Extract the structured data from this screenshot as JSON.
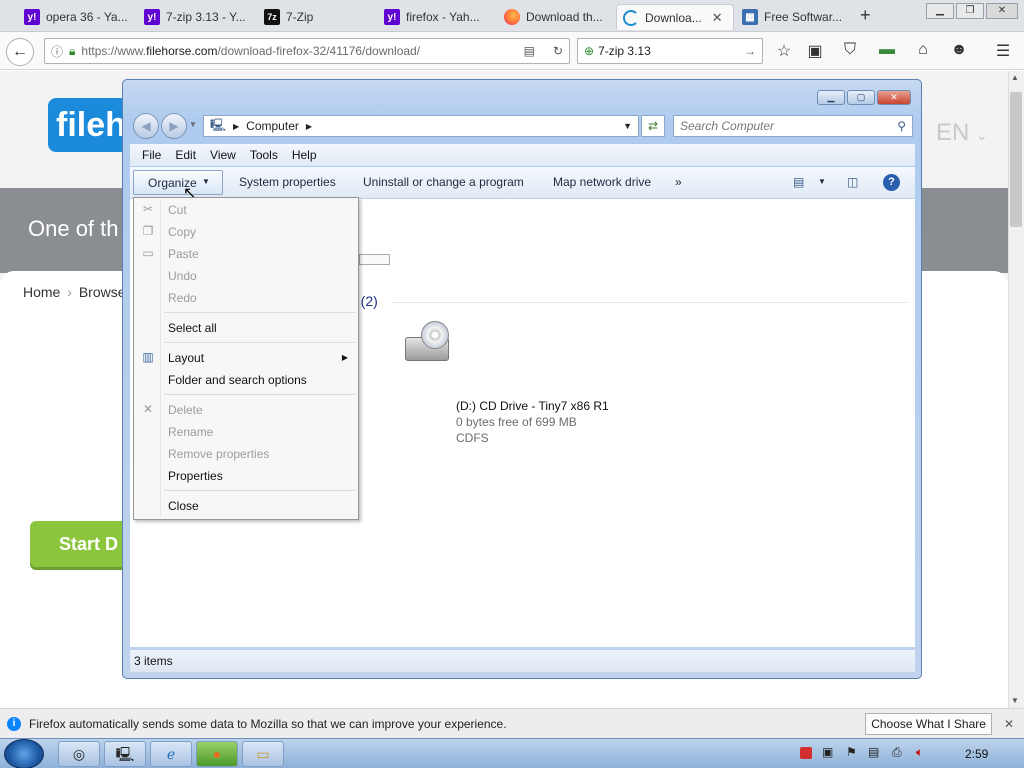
{
  "browser": {
    "tabs": [
      {
        "label": "opera 36 - Ya...",
        "icon": "yahoo-icon"
      },
      {
        "label": "7-zip 3.13 - Y...",
        "icon": "yahoo-icon"
      },
      {
        "label": "7-Zip",
        "icon": "7zip-icon"
      },
      {
        "label": "firefox - Yah...",
        "icon": "yahoo-icon"
      },
      {
        "label": "Download th...",
        "icon": "firefox-icon"
      },
      {
        "label": "Downloa...",
        "icon": "loading-icon",
        "active": true
      },
      {
        "label": "Free Softwar...",
        "icon": "filehorse-icon"
      }
    ],
    "new_tab": "+",
    "url_prefix": "https://www.",
    "url_domain": "filehorse.com",
    "url_path": "/download-firefox-32/41176/download/",
    "search_value": "7-zip 3.13"
  },
  "page": {
    "logo_text": "fileh",
    "lang": "EN",
    "banner_text": "One of th",
    "breadcrumb_home": "Home",
    "breadcrumb_browse": "Browse",
    "start_button": "Start D"
  },
  "explorer": {
    "address_root": "Computer",
    "search_placeholder": "Search Computer",
    "menu": [
      "File",
      "Edit",
      "View",
      "Tools",
      "Help"
    ],
    "commands": {
      "organize": "Organize",
      "system_properties": "System properties",
      "uninstall": "Uninstall or change a program",
      "map_drive": "Map network drive",
      "more": "»"
    },
    "group_header": "e (2)",
    "drive": {
      "name": "(D:) CD Drive - Tiny7 x86 R1",
      "free": "0 bytes free of 699 MB",
      "fs": "CDFS"
    },
    "status": "3 items"
  },
  "organize_menu": [
    {
      "label": "Cut",
      "disabled": true
    },
    {
      "label": "Copy",
      "disabled": true
    },
    {
      "label": "Paste",
      "disabled": true
    },
    {
      "label": "Undo",
      "disabled": true
    },
    {
      "label": "Redo",
      "disabled": true
    },
    {
      "label": "Select all",
      "disabled": false
    },
    {
      "label": "Layout",
      "disabled": false
    },
    {
      "label": "Folder and search options",
      "disabled": false
    },
    {
      "label": "Delete",
      "disabled": true
    },
    {
      "label": "Rename",
      "disabled": true
    },
    {
      "label": "Remove properties",
      "disabled": true
    },
    {
      "label": "Properties",
      "disabled": false
    },
    {
      "label": "Close",
      "disabled": false
    }
  ],
  "notification": {
    "text": "Firefox automatically sends some data to Mozilla so that we can improve your experience.",
    "button": "Choose What I Share"
  },
  "taskbar": {
    "clock": "2:59"
  },
  "colors": {
    "accent_green": "#8cc63f",
    "filehorse_blue": "#1c8adb"
  }
}
